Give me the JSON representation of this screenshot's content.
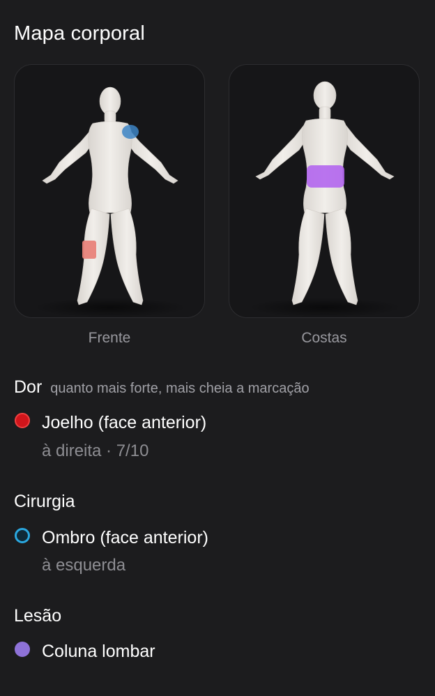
{
  "header": {
    "title": "Mapa corporal"
  },
  "views": {
    "front_label": "Frente",
    "back_label": "Costas"
  },
  "sections": {
    "dor": {
      "title": "Dor",
      "hint": "quanto mais forte, mais cheia a marcação",
      "items": [
        {
          "name": "Joelho (face anterior)",
          "detail": "à direita · 7/10",
          "color": "#d1151b",
          "style": "filled"
        }
      ]
    },
    "cirurgia": {
      "title": "Cirurgia",
      "items": [
        {
          "name": "Ombro (face anterior)",
          "detail": "à esquerda",
          "color": "#2aa8e0",
          "style": "ring"
        }
      ]
    },
    "lesao": {
      "title": "Lesão",
      "items": [
        {
          "name": "Coluna lombar",
          "color": "#8e72d8",
          "style": "filled"
        }
      ]
    }
  },
  "markers": {
    "knee_color": "#e8837a",
    "shoulder_color": "#3d85c6",
    "lumbar_color": "#b266ee"
  }
}
